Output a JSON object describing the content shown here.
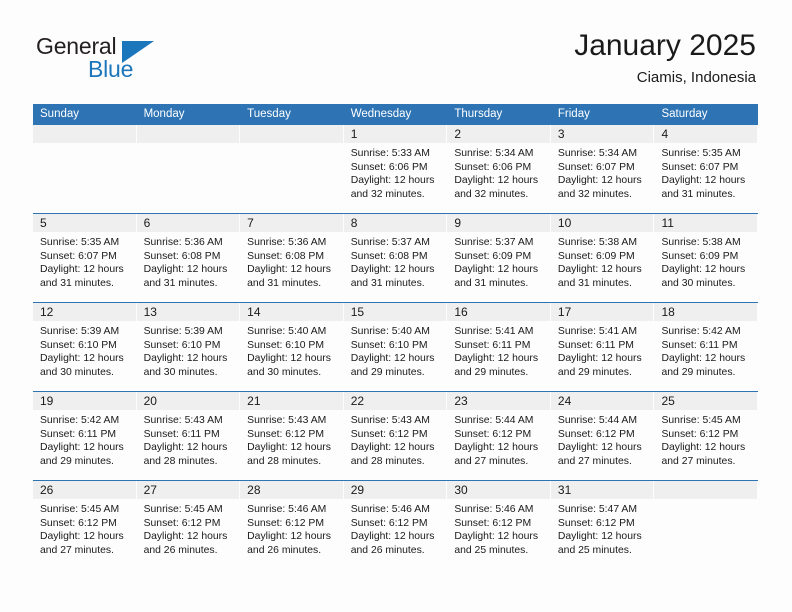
{
  "brand": {
    "name_top": "General",
    "name_bottom": "Blue",
    "accent_color": "#1B76BC"
  },
  "header": {
    "title": "January 2025",
    "subtitle": "Ciamis, Indonesia"
  },
  "theme": {
    "header_blue": "#2E74B5",
    "band_gray": "#EFEFEF",
    "page_bg": "#FDFDFD",
    "text": "#1A1A1A"
  },
  "weekdays": [
    "Sunday",
    "Monday",
    "Tuesday",
    "Wednesday",
    "Thursday",
    "Friday",
    "Saturday"
  ],
  "labels": {
    "sunrise_prefix": "Sunrise:",
    "sunset_prefix": "Sunset:",
    "daylight_prefix": "Daylight:"
  },
  "weeks": [
    [
      {
        "day": "",
        "empty": true
      },
      {
        "day": "",
        "empty": true
      },
      {
        "day": "",
        "empty": true
      },
      {
        "day": "1",
        "sunrise": "Sunrise: 5:33 AM",
        "sunset": "Sunset: 6:06 PM",
        "daylight_line1": "Daylight: 12 hours",
        "daylight_line2": "and 32 minutes."
      },
      {
        "day": "2",
        "sunrise": "Sunrise: 5:34 AM",
        "sunset": "Sunset: 6:06 PM",
        "daylight_line1": "Daylight: 12 hours",
        "daylight_line2": "and 32 minutes."
      },
      {
        "day": "3",
        "sunrise": "Sunrise: 5:34 AM",
        "sunset": "Sunset: 6:07 PM",
        "daylight_line1": "Daylight: 12 hours",
        "daylight_line2": "and 32 minutes."
      },
      {
        "day": "4",
        "sunrise": "Sunrise: 5:35 AM",
        "sunset": "Sunset: 6:07 PM",
        "daylight_line1": "Daylight: 12 hours",
        "daylight_line2": "and 31 minutes."
      }
    ],
    [
      {
        "day": "5",
        "sunrise": "Sunrise: 5:35 AM",
        "sunset": "Sunset: 6:07 PM",
        "daylight_line1": "Daylight: 12 hours",
        "daylight_line2": "and 31 minutes."
      },
      {
        "day": "6",
        "sunrise": "Sunrise: 5:36 AM",
        "sunset": "Sunset: 6:08 PM",
        "daylight_line1": "Daylight: 12 hours",
        "daylight_line2": "and 31 minutes."
      },
      {
        "day": "7",
        "sunrise": "Sunrise: 5:36 AM",
        "sunset": "Sunset: 6:08 PM",
        "daylight_line1": "Daylight: 12 hours",
        "daylight_line2": "and 31 minutes."
      },
      {
        "day": "8",
        "sunrise": "Sunrise: 5:37 AM",
        "sunset": "Sunset: 6:08 PM",
        "daylight_line1": "Daylight: 12 hours",
        "daylight_line2": "and 31 minutes."
      },
      {
        "day": "9",
        "sunrise": "Sunrise: 5:37 AM",
        "sunset": "Sunset: 6:09 PM",
        "daylight_line1": "Daylight: 12 hours",
        "daylight_line2": "and 31 minutes."
      },
      {
        "day": "10",
        "sunrise": "Sunrise: 5:38 AM",
        "sunset": "Sunset: 6:09 PM",
        "daylight_line1": "Daylight: 12 hours",
        "daylight_line2": "and 31 minutes."
      },
      {
        "day": "11",
        "sunrise": "Sunrise: 5:38 AM",
        "sunset": "Sunset: 6:09 PM",
        "daylight_line1": "Daylight: 12 hours",
        "daylight_line2": "and 30 minutes."
      }
    ],
    [
      {
        "day": "12",
        "sunrise": "Sunrise: 5:39 AM",
        "sunset": "Sunset: 6:10 PM",
        "daylight_line1": "Daylight: 12 hours",
        "daylight_line2": "and 30 minutes."
      },
      {
        "day": "13",
        "sunrise": "Sunrise: 5:39 AM",
        "sunset": "Sunset: 6:10 PM",
        "daylight_line1": "Daylight: 12 hours",
        "daylight_line2": "and 30 minutes."
      },
      {
        "day": "14",
        "sunrise": "Sunrise: 5:40 AM",
        "sunset": "Sunset: 6:10 PM",
        "daylight_line1": "Daylight: 12 hours",
        "daylight_line2": "and 30 minutes."
      },
      {
        "day": "15",
        "sunrise": "Sunrise: 5:40 AM",
        "sunset": "Sunset: 6:10 PM",
        "daylight_line1": "Daylight: 12 hours",
        "daylight_line2": "and 29 minutes."
      },
      {
        "day": "16",
        "sunrise": "Sunrise: 5:41 AM",
        "sunset": "Sunset: 6:11 PM",
        "daylight_line1": "Daylight: 12 hours",
        "daylight_line2": "and 29 minutes."
      },
      {
        "day": "17",
        "sunrise": "Sunrise: 5:41 AM",
        "sunset": "Sunset: 6:11 PM",
        "daylight_line1": "Daylight: 12 hours",
        "daylight_line2": "and 29 minutes."
      },
      {
        "day": "18",
        "sunrise": "Sunrise: 5:42 AM",
        "sunset": "Sunset: 6:11 PM",
        "daylight_line1": "Daylight: 12 hours",
        "daylight_line2": "and 29 minutes."
      }
    ],
    [
      {
        "day": "19",
        "sunrise": "Sunrise: 5:42 AM",
        "sunset": "Sunset: 6:11 PM",
        "daylight_line1": "Daylight: 12 hours",
        "daylight_line2": "and 29 minutes."
      },
      {
        "day": "20",
        "sunrise": "Sunrise: 5:43 AM",
        "sunset": "Sunset: 6:11 PM",
        "daylight_line1": "Daylight: 12 hours",
        "daylight_line2": "and 28 minutes."
      },
      {
        "day": "21",
        "sunrise": "Sunrise: 5:43 AM",
        "sunset": "Sunset: 6:12 PM",
        "daylight_line1": "Daylight: 12 hours",
        "daylight_line2": "and 28 minutes."
      },
      {
        "day": "22",
        "sunrise": "Sunrise: 5:43 AM",
        "sunset": "Sunset: 6:12 PM",
        "daylight_line1": "Daylight: 12 hours",
        "daylight_line2": "and 28 minutes."
      },
      {
        "day": "23",
        "sunrise": "Sunrise: 5:44 AM",
        "sunset": "Sunset: 6:12 PM",
        "daylight_line1": "Daylight: 12 hours",
        "daylight_line2": "and 27 minutes."
      },
      {
        "day": "24",
        "sunrise": "Sunrise: 5:44 AM",
        "sunset": "Sunset: 6:12 PM",
        "daylight_line1": "Daylight: 12 hours",
        "daylight_line2": "and 27 minutes."
      },
      {
        "day": "25",
        "sunrise": "Sunrise: 5:45 AM",
        "sunset": "Sunset: 6:12 PM",
        "daylight_line1": "Daylight: 12 hours",
        "daylight_line2": "and 27 minutes."
      }
    ],
    [
      {
        "day": "26",
        "sunrise": "Sunrise: 5:45 AM",
        "sunset": "Sunset: 6:12 PM",
        "daylight_line1": "Daylight: 12 hours",
        "daylight_line2": "and 27 minutes."
      },
      {
        "day": "27",
        "sunrise": "Sunrise: 5:45 AM",
        "sunset": "Sunset: 6:12 PM",
        "daylight_line1": "Daylight: 12 hours",
        "daylight_line2": "and 26 minutes."
      },
      {
        "day": "28",
        "sunrise": "Sunrise: 5:46 AM",
        "sunset": "Sunset: 6:12 PM",
        "daylight_line1": "Daylight: 12 hours",
        "daylight_line2": "and 26 minutes."
      },
      {
        "day": "29",
        "sunrise": "Sunrise: 5:46 AM",
        "sunset": "Sunset: 6:12 PM",
        "daylight_line1": "Daylight: 12 hours",
        "daylight_line2": "and 26 minutes."
      },
      {
        "day": "30",
        "sunrise": "Sunrise: 5:46 AM",
        "sunset": "Sunset: 6:12 PM",
        "daylight_line1": "Daylight: 12 hours",
        "daylight_line2": "and 25 minutes."
      },
      {
        "day": "31",
        "sunrise": "Sunrise: 5:47 AM",
        "sunset": "Sunset: 6:12 PM",
        "daylight_line1": "Daylight: 12 hours",
        "daylight_line2": "and 25 minutes."
      },
      {
        "day": "",
        "empty": true
      }
    ]
  ]
}
